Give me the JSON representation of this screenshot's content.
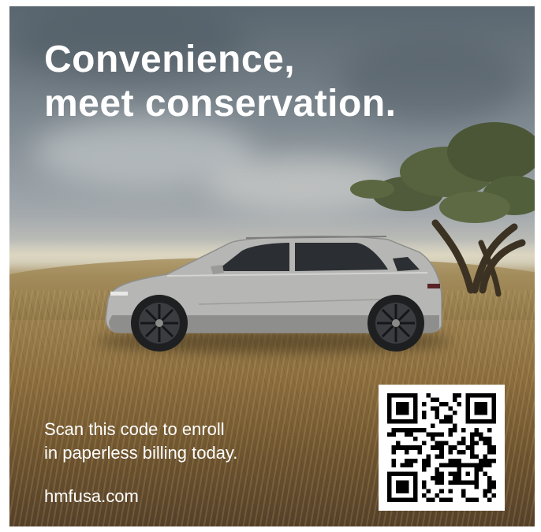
{
  "ad": {
    "headline_line1": "Convenience,",
    "headline_line2": "meet conservation.",
    "cta_line1": "Scan this code to enroll",
    "cta_line2": "in paperless billing today.",
    "url": "hmfusa.com"
  },
  "images": {
    "car": "silver-suv-side-view",
    "tree": "windswept-tree",
    "qr": "qr-code"
  },
  "colors": {
    "text": "#ffffff",
    "qr_dark": "#000000",
    "qr_light": "#ffffff"
  }
}
